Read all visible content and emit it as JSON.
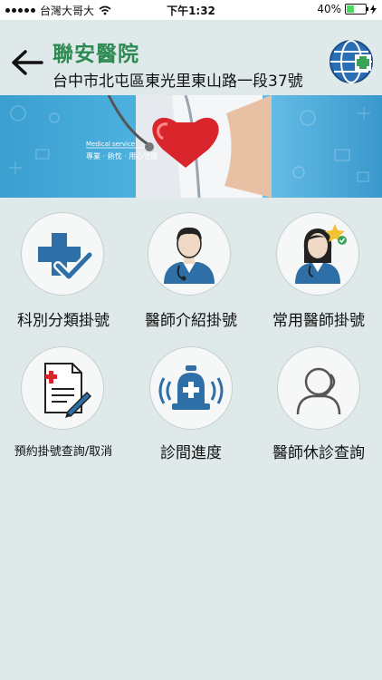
{
  "status_bar": {
    "carrier": "台灣大哥大",
    "time": "下午1:32",
    "battery": "40%",
    "battery_level": 0.4
  },
  "header": {
    "hospital_name": "聯安醫院",
    "address": "台中市北屯區東光里東山路一段37號"
  },
  "banner": {
    "tag": "Medical service",
    "slogan": "專業 · 熱忱 · 用心守護"
  },
  "menu": [
    {
      "label": "科別分類掛號",
      "icon": "medical-cross-check-icon"
    },
    {
      "label": "醫師介紹掛號",
      "icon": "male-doctor-icon"
    },
    {
      "label": "常用醫師掛號",
      "icon": "female-doctor-star-icon"
    },
    {
      "label": "預約掛號查詢/取消",
      "icon": "document-pen-icon"
    },
    {
      "label": "診間進度",
      "icon": "alarm-bell-icon"
    },
    {
      "label": "醫師休診查詢",
      "icon": "doctor-headset-icon"
    }
  ],
  "colors": {
    "brand_green": "#2d8a52",
    "icon_blue": "#2f6fa8",
    "background": "#dfe9ea"
  }
}
